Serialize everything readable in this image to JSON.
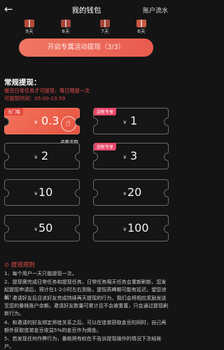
{
  "header": {
    "back_icon": "arrow-left-icon",
    "title": "我的钱包",
    "ledger": "账户流水"
  },
  "days": [
    {
      "label": "9天",
      "color": "#b64b3a"
    },
    {
      "label": "8天",
      "color": "#a4453a"
    },
    {
      "label": "7天",
      "color": "#a4453a"
    },
    {
      "label": "6天",
      "color": "#c85a44"
    }
  ],
  "activity_button": "开启专属活动提现（3/3）",
  "withdraw": {
    "title": "常规提现：",
    "warning1": "做完日常任务才可提现，每日限提一次",
    "warning2": "可提现时间：05:00-23:59",
    "cards": [
      {
        "tag": "无门槛",
        "currency": "¥",
        "amount": "0.3"
      },
      {
        "tag": "迎新专享",
        "currency": "¥",
        "amount": "1"
      },
      {
        "tag": "",
        "currency": "¥",
        "amount": "2"
      },
      {
        "tag": "迎新专享",
        "currency": "¥",
        "amount": "3"
      },
      {
        "tag": "",
        "currency": "¥",
        "amount": "10"
      },
      {
        "tag": "",
        "currency": "¥",
        "amount": "20"
      },
      {
        "tag": "",
        "currency": "¥",
        "amount": "50"
      },
      {
        "tag": "",
        "currency": "¥",
        "amount": "100"
      }
    ],
    "tap_hint": "点我去取"
  },
  "rules": {
    "heading": "提现规则",
    "items": [
      "1、每个用户一天只能提现一次。",
      "2、提现需完成日常任务和提现任务，日常任务隔天任务会重新刷新。您发起提现申请后，预计在1-2小时左右到账，提现高峰期可能有延迟，望您谅解！",
      "3、邀请好友后且该好友完成持续再天提现的行为，我们会将相应奖励发送至您的番桃账户余额。邀请好友数量可累计且不会被重置，只会通过提现刷新行为。",
      "4、和邀请的好友绑定师徒关系之后，可以在徒弟获取金豆的同时，自己再额外获取徒弟金豆收益5%的金豆作为佣金。",
      "5、若发现任何作弊行为，番桃将有权在不告诉提现操作的情况下冻结账户。"
    ]
  },
  "colors": {
    "accent": "#e95b4f",
    "warning": "#e24b4b",
    "background": "#141414"
  }
}
